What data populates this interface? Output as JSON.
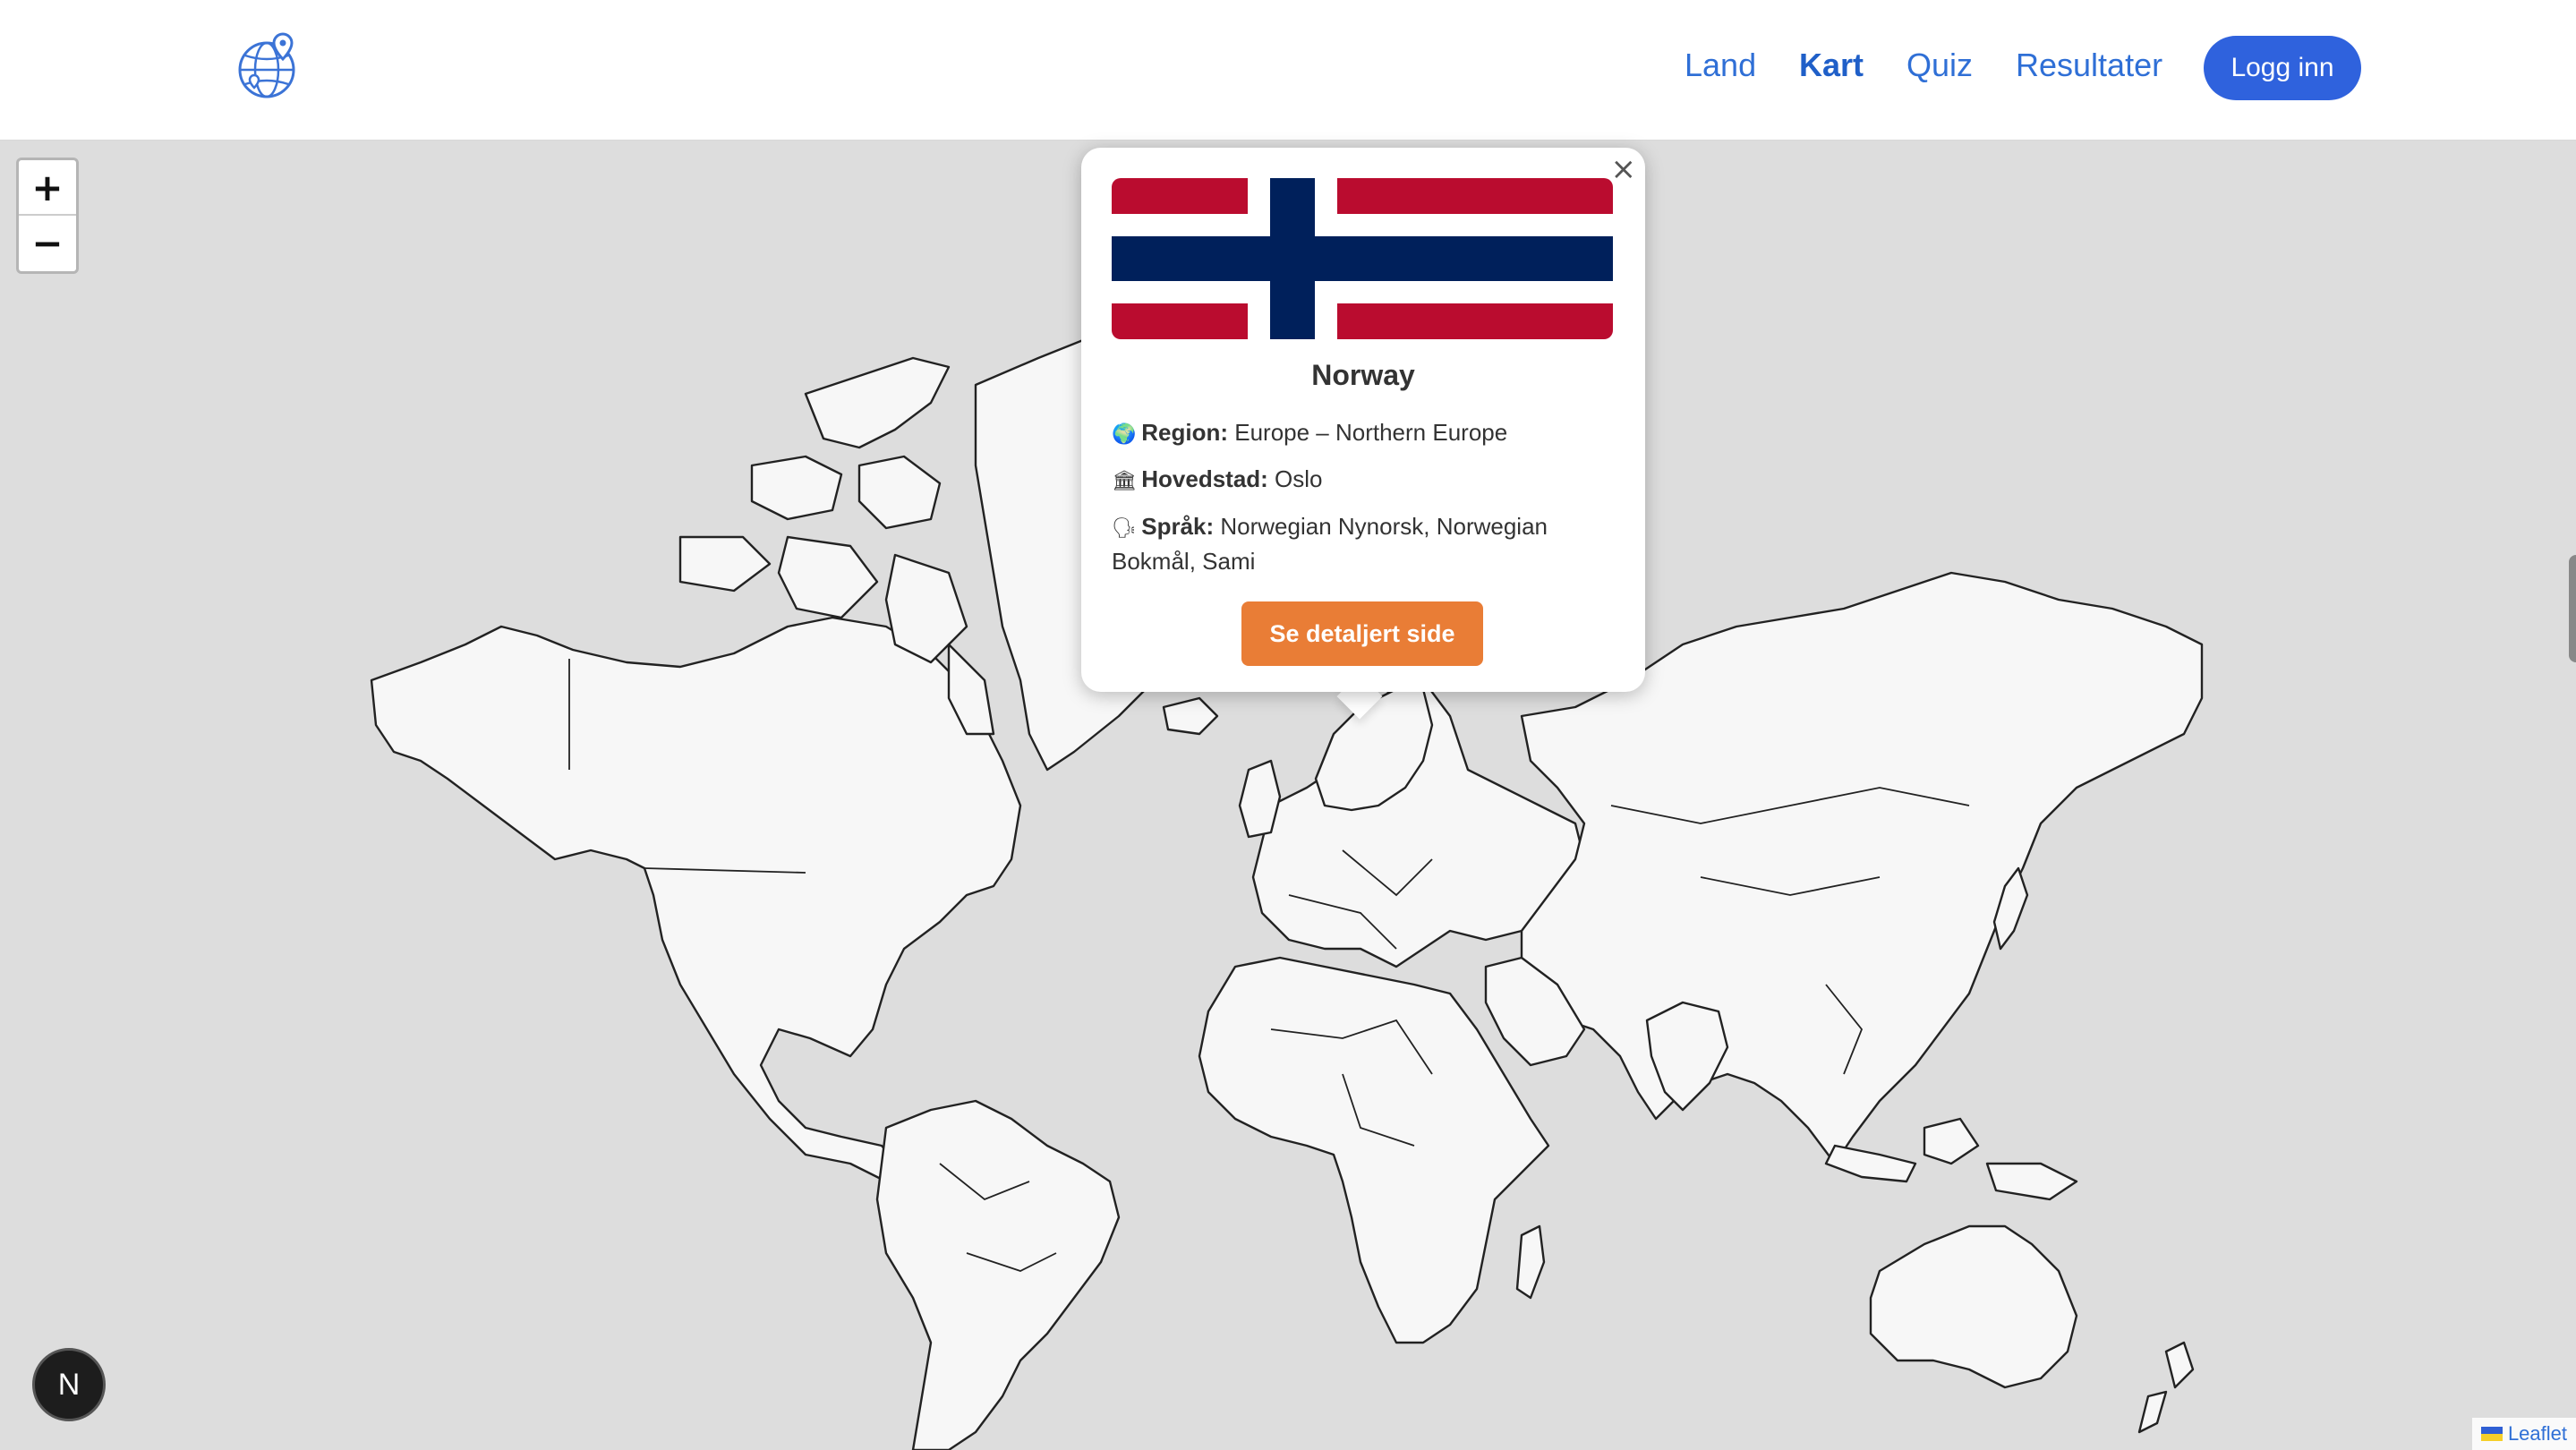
{
  "header": {
    "logo_icon": "globe-pin-icon",
    "nav": [
      {
        "label": "Land",
        "active": false
      },
      {
        "label": "Kart",
        "active": true
      },
      {
        "label": "Quiz",
        "active": false
      },
      {
        "label": "Resultater",
        "active": false
      }
    ],
    "login_label": "Logg inn"
  },
  "map": {
    "zoom_in_label": "+",
    "zoom_out_label": "−",
    "attribution": "Leaflet",
    "popup": {
      "close_label": "×",
      "country": "Norway",
      "region_label": "Region:",
      "region_value": "Europe – Northern Europe",
      "capital_label": "Hovedstad:",
      "capital_value": "Oslo",
      "languages_label": "Språk:",
      "languages_value": "Norwegian Nynorsk, Norwegian Bokmål, Sami",
      "detail_button": "Se detaljert side",
      "region_icon": "globe-icon",
      "capital_icon": "building-icon",
      "language_icon": "speech-icon"
    }
  },
  "badge_letter": "N",
  "colors": {
    "accent_blue": "#2f62dd",
    "button_orange": "#e97d36",
    "flag_red": "#ba0c2f",
    "flag_blue": "#00205b",
    "land": "#f7f7f7",
    "water": "#dddddd"
  }
}
